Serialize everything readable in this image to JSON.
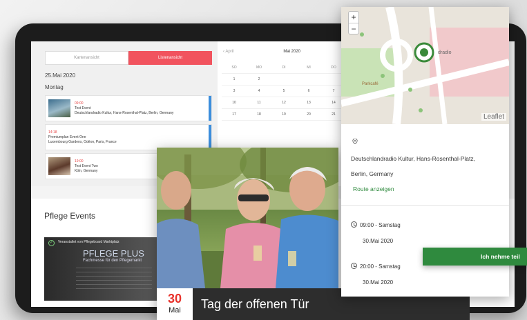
{
  "list": {
    "tab_map": "Kartenansicht",
    "tab_list": "Listenansicht",
    "date": "25.Mai 2020",
    "weekday": "Montag",
    "events": [
      {
        "time": "09:00",
        "title": "Test Event",
        "location": "Deutschlandradio Kultur, Hans-Rosenthal-Platz, Berlin, Germany"
      },
      {
        "time": "14:18",
        "title": "Premiumplan Event One",
        "location": "Luxembourg Gardens, Odéon, Paris, France"
      },
      {
        "time": "19:00",
        "title": "Test Event Two",
        "location": "Köln, Germany"
      }
    ]
  },
  "calendar": {
    "prev": "‹ April",
    "month": "Mai 2020",
    "day_headers": [
      "SO",
      "MO",
      "DI",
      "MI",
      "DO"
    ],
    "weeks": [
      [
        "1",
        "2",
        "",
        "",
        ""
      ],
      [
        "3",
        "4",
        "5",
        "6",
        "7"
      ],
      [
        "10",
        "11",
        "12",
        "13",
        "14"
      ],
      [
        "17",
        "18",
        "19",
        "20",
        "21"
      ]
    ]
  },
  "pflege": {
    "title": "Pflege Events",
    "organizer": "Veranstaltet von Pflegeboard Marktplatz",
    "card_title": "PFLEGE PLUS",
    "card_subtitle": "Fachmesse für den Pflegemarkt"
  },
  "event_card": {
    "day": "30",
    "month": "Mai",
    "title": "Tag der offenen Tür"
  },
  "detail": {
    "zoom_in": "+",
    "zoom_out": "−",
    "attribution": "Leaflet",
    "address_line1": "Deutschlandradio Kultur, Hans-Rosenthal-Platz,",
    "address_line2": "Berlin, Germany",
    "route_label": "Route anzeigen",
    "start_time": "09:00 - Samstag",
    "start_date": "30.Mai 2020",
    "end_time": "20:00 - Samstag",
    "end_date": "30.Mai 2020",
    "cta_label": "Ich nehme teil"
  },
  "colors": {
    "accent_red": "#f1535e",
    "green": "#2f8a3e",
    "date_red": "#e8322b"
  }
}
